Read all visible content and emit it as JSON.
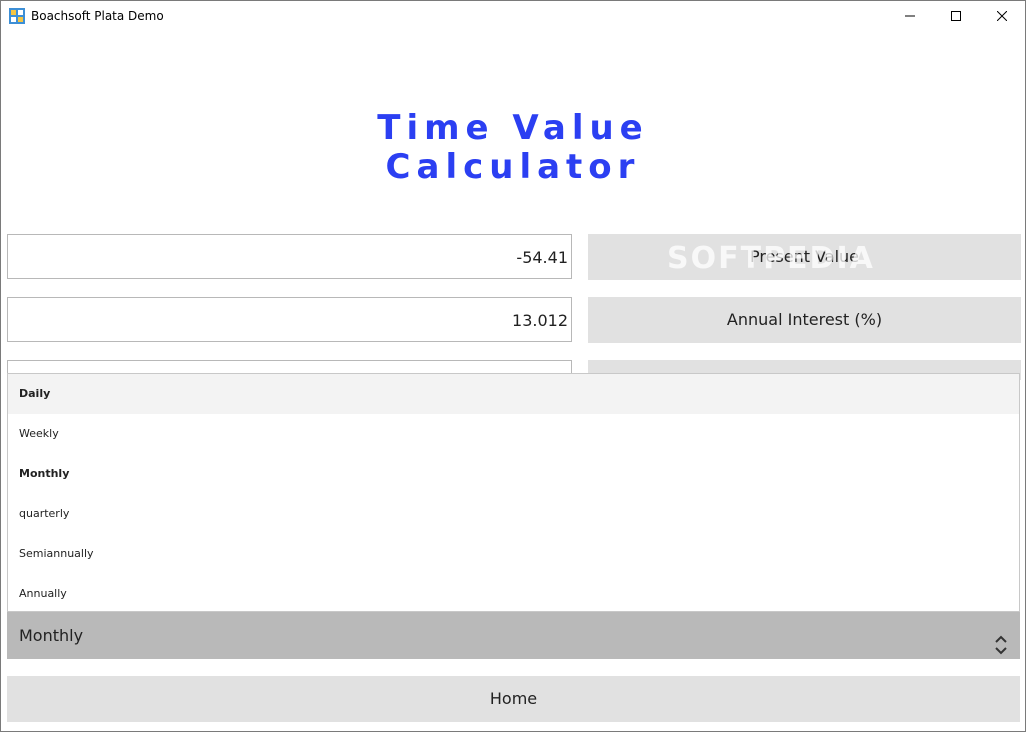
{
  "window": {
    "title": "Boachsoft Plata Demo"
  },
  "heading": {
    "line1": "Time Value",
    "line2": "Calculator",
    "color": "#2b3ff2"
  },
  "rows": [
    {
      "value": "-54.41",
      "label": "Present Value"
    },
    {
      "value": "13.012",
      "label": "Annual Interest (%)"
    }
  ],
  "watermark": "SOFTPEDIA",
  "compounding": {
    "options": [
      "Daily",
      "Weekly",
      "Monthly",
      "quarterly",
      "Semiannually",
      "Annually"
    ],
    "selected": "Monthly",
    "hovered": "Daily"
  },
  "home_button": "Home",
  "icons": [
    "app-icon",
    "minimize-icon",
    "maximize-icon",
    "close-icon",
    "combo-updown-icon"
  ]
}
